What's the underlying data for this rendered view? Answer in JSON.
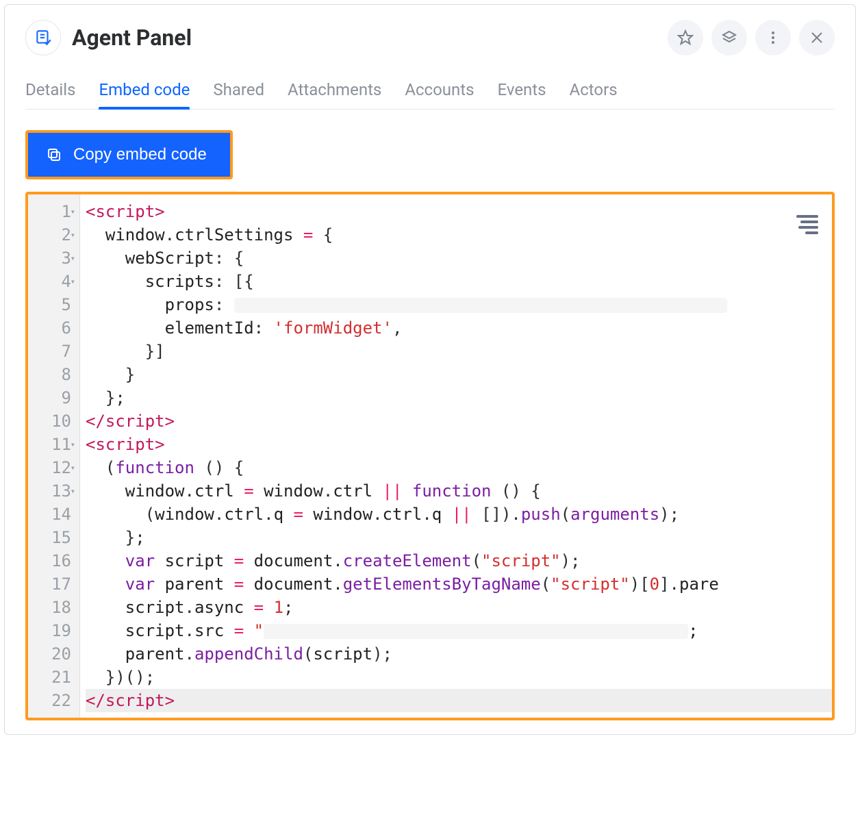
{
  "header": {
    "title": "Agent Panel"
  },
  "tabs": [
    {
      "label": "Details",
      "active": false
    },
    {
      "label": "Embed code",
      "active": true
    },
    {
      "label": "Shared",
      "active": false
    },
    {
      "label": "Attachments",
      "active": false
    },
    {
      "label": "Accounts",
      "active": false
    },
    {
      "label": "Events",
      "active": false
    },
    {
      "label": "Actors",
      "active": false
    }
  ],
  "actions": {
    "copy_label": "Copy embed code"
  },
  "editor": {
    "line_count": 22,
    "fold_lines": [
      1,
      2,
      3,
      4,
      11,
      12,
      13
    ],
    "code_lines": [
      {
        "n": 1,
        "html": "<span class='tk-tag'>&lt;script&gt;</span>"
      },
      {
        "n": 2,
        "html": "  <span class='tk-plain'>window</span>.<span class='tk-plain'>ctrlSettings</span> <span class='tk-op'>=</span> {"
      },
      {
        "n": 3,
        "html": "    <span class='tk-plain'>webScript</span>: {"
      },
      {
        "n": 4,
        "html": "      <span class='tk-plain'>scripts</span>: [{"
      },
      {
        "n": 5,
        "html": "        <span class='tk-plain'>props</span>: <span class='redact w1'></span>"
      },
      {
        "n": 6,
        "html": "        <span class='tk-plain'>elementId</span>: <span class='tk-str'>'formWidget'</span>,"
      },
      {
        "n": 7,
        "html": "      }]"
      },
      {
        "n": 8,
        "html": "    }"
      },
      {
        "n": 9,
        "html": "  };"
      },
      {
        "n": 10,
        "html": "<span class='tk-tag'>&lt;/script&gt;</span>"
      },
      {
        "n": 11,
        "html": "<span class='tk-tag'>&lt;script&gt;</span>"
      },
      {
        "n": 12,
        "html": "  (<span class='tk-kw'>function</span> () {"
      },
      {
        "n": 13,
        "html": "    <span class='tk-plain'>window</span>.<span class='tk-plain'>ctrl</span> <span class='tk-op'>=</span> <span class='tk-plain'>window</span>.<span class='tk-plain'>ctrl</span> <span class='tk-op'>||</span> <span class='tk-kw'>function</span> () {"
      },
      {
        "n": 14,
        "html": "      (<span class='tk-plain'>window</span>.<span class='tk-plain'>ctrl</span>.<span class='tk-plain'>q</span> <span class='tk-op'>=</span> <span class='tk-plain'>window</span>.<span class='tk-plain'>ctrl</span>.<span class='tk-plain'>q</span> <span class='tk-op'>||</span> []).<span class='tk-fn'>push</span>(<span class='tk-id'>arguments</span>);"
      },
      {
        "n": 15,
        "html": "    };"
      },
      {
        "n": 16,
        "html": "    <span class='tk-kw'>var</span> <span class='tk-plain'>script</span> <span class='tk-op'>=</span> <span class='tk-plain'>document</span>.<span class='tk-fn'>createElement</span>(<span class='tk-str'>\"script\"</span>);"
      },
      {
        "n": 17,
        "html": "    <span class='tk-kw'>var</span> <span class='tk-plain'>parent</span> <span class='tk-op'>=</span> <span class='tk-plain'>document</span>.<span class='tk-fn'>getElementsByTagName</span>(<span class='tk-str'>\"script\"</span>)[<span class='tk-num'>0</span>].<span class='tk-plain'>pare</span>"
      },
      {
        "n": 18,
        "html": "    <span class='tk-plain'>script</span>.<span class='tk-plain'>async</span> <span class='tk-op'>=</span> <span class='tk-num'>1</span>;"
      },
      {
        "n": 19,
        "html": "    <span class='tk-plain'>script</span>.<span class='tk-plain'>src</span> <span class='tk-op'>=</span> <span class='tk-str'>\"</span><span class='redact w2'></span><span class='tk-plain'>;</span>"
      },
      {
        "n": 20,
        "html": "    <span class='tk-plain'>parent</span>.<span class='tk-fn'>appendChild</span>(<span class='tk-plain'>script</span>);"
      },
      {
        "n": 21,
        "html": "  })();"
      },
      {
        "n": 22,
        "html": "<span class='tk-tag'>&lt;/script&gt;</span>",
        "hl": true
      }
    ]
  }
}
